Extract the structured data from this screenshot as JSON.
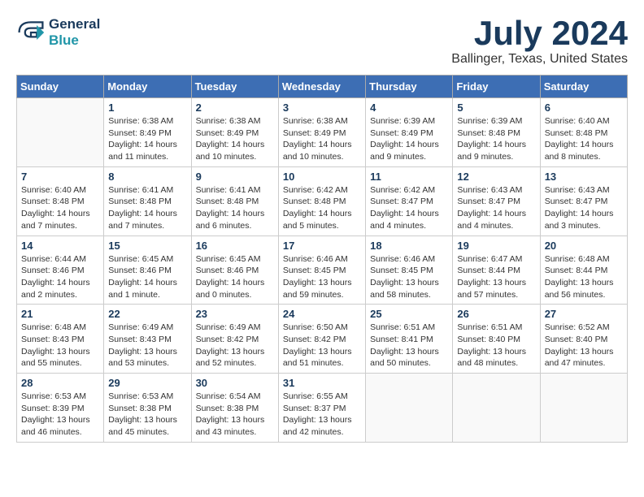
{
  "header": {
    "logo_line1": "General",
    "logo_line2": "Blue",
    "month": "July 2024",
    "location": "Ballinger, Texas, United States"
  },
  "weekdays": [
    "Sunday",
    "Monday",
    "Tuesday",
    "Wednesday",
    "Thursday",
    "Friday",
    "Saturday"
  ],
  "weeks": [
    [
      {
        "day": "",
        "info": ""
      },
      {
        "day": "1",
        "info": "Sunrise: 6:38 AM\nSunset: 8:49 PM\nDaylight: 14 hours\nand 11 minutes."
      },
      {
        "day": "2",
        "info": "Sunrise: 6:38 AM\nSunset: 8:49 PM\nDaylight: 14 hours\nand 10 minutes."
      },
      {
        "day": "3",
        "info": "Sunrise: 6:38 AM\nSunset: 8:49 PM\nDaylight: 14 hours\nand 10 minutes."
      },
      {
        "day": "4",
        "info": "Sunrise: 6:39 AM\nSunset: 8:49 PM\nDaylight: 14 hours\nand 9 minutes."
      },
      {
        "day": "5",
        "info": "Sunrise: 6:39 AM\nSunset: 8:48 PM\nDaylight: 14 hours\nand 9 minutes."
      },
      {
        "day": "6",
        "info": "Sunrise: 6:40 AM\nSunset: 8:48 PM\nDaylight: 14 hours\nand 8 minutes."
      }
    ],
    [
      {
        "day": "7",
        "info": "Sunrise: 6:40 AM\nSunset: 8:48 PM\nDaylight: 14 hours\nand 7 minutes."
      },
      {
        "day": "8",
        "info": "Sunrise: 6:41 AM\nSunset: 8:48 PM\nDaylight: 14 hours\nand 7 minutes."
      },
      {
        "day": "9",
        "info": "Sunrise: 6:41 AM\nSunset: 8:48 PM\nDaylight: 14 hours\nand 6 minutes."
      },
      {
        "day": "10",
        "info": "Sunrise: 6:42 AM\nSunset: 8:48 PM\nDaylight: 14 hours\nand 5 minutes."
      },
      {
        "day": "11",
        "info": "Sunrise: 6:42 AM\nSunset: 8:47 PM\nDaylight: 14 hours\nand 4 minutes."
      },
      {
        "day": "12",
        "info": "Sunrise: 6:43 AM\nSunset: 8:47 PM\nDaylight: 14 hours\nand 4 minutes."
      },
      {
        "day": "13",
        "info": "Sunrise: 6:43 AM\nSunset: 8:47 PM\nDaylight: 14 hours\nand 3 minutes."
      }
    ],
    [
      {
        "day": "14",
        "info": "Sunrise: 6:44 AM\nSunset: 8:46 PM\nDaylight: 14 hours\nand 2 minutes."
      },
      {
        "day": "15",
        "info": "Sunrise: 6:45 AM\nSunset: 8:46 PM\nDaylight: 14 hours\nand 1 minute."
      },
      {
        "day": "16",
        "info": "Sunrise: 6:45 AM\nSunset: 8:46 PM\nDaylight: 14 hours\nand 0 minutes."
      },
      {
        "day": "17",
        "info": "Sunrise: 6:46 AM\nSunset: 8:45 PM\nDaylight: 13 hours\nand 59 minutes."
      },
      {
        "day": "18",
        "info": "Sunrise: 6:46 AM\nSunset: 8:45 PM\nDaylight: 13 hours\nand 58 minutes."
      },
      {
        "day": "19",
        "info": "Sunrise: 6:47 AM\nSunset: 8:44 PM\nDaylight: 13 hours\nand 57 minutes."
      },
      {
        "day": "20",
        "info": "Sunrise: 6:48 AM\nSunset: 8:44 PM\nDaylight: 13 hours\nand 56 minutes."
      }
    ],
    [
      {
        "day": "21",
        "info": "Sunrise: 6:48 AM\nSunset: 8:43 PM\nDaylight: 13 hours\nand 55 minutes."
      },
      {
        "day": "22",
        "info": "Sunrise: 6:49 AM\nSunset: 8:43 PM\nDaylight: 13 hours\nand 53 minutes."
      },
      {
        "day": "23",
        "info": "Sunrise: 6:49 AM\nSunset: 8:42 PM\nDaylight: 13 hours\nand 52 minutes."
      },
      {
        "day": "24",
        "info": "Sunrise: 6:50 AM\nSunset: 8:42 PM\nDaylight: 13 hours\nand 51 minutes."
      },
      {
        "day": "25",
        "info": "Sunrise: 6:51 AM\nSunset: 8:41 PM\nDaylight: 13 hours\nand 50 minutes."
      },
      {
        "day": "26",
        "info": "Sunrise: 6:51 AM\nSunset: 8:40 PM\nDaylight: 13 hours\nand 48 minutes."
      },
      {
        "day": "27",
        "info": "Sunrise: 6:52 AM\nSunset: 8:40 PM\nDaylight: 13 hours\nand 47 minutes."
      }
    ],
    [
      {
        "day": "28",
        "info": "Sunrise: 6:53 AM\nSunset: 8:39 PM\nDaylight: 13 hours\nand 46 minutes."
      },
      {
        "day": "29",
        "info": "Sunrise: 6:53 AM\nSunset: 8:38 PM\nDaylight: 13 hours\nand 45 minutes."
      },
      {
        "day": "30",
        "info": "Sunrise: 6:54 AM\nSunset: 8:38 PM\nDaylight: 13 hours\nand 43 minutes."
      },
      {
        "day": "31",
        "info": "Sunrise: 6:55 AM\nSunset: 8:37 PM\nDaylight: 13 hours\nand 42 minutes."
      },
      {
        "day": "",
        "info": ""
      },
      {
        "day": "",
        "info": ""
      },
      {
        "day": "",
        "info": ""
      }
    ]
  ]
}
